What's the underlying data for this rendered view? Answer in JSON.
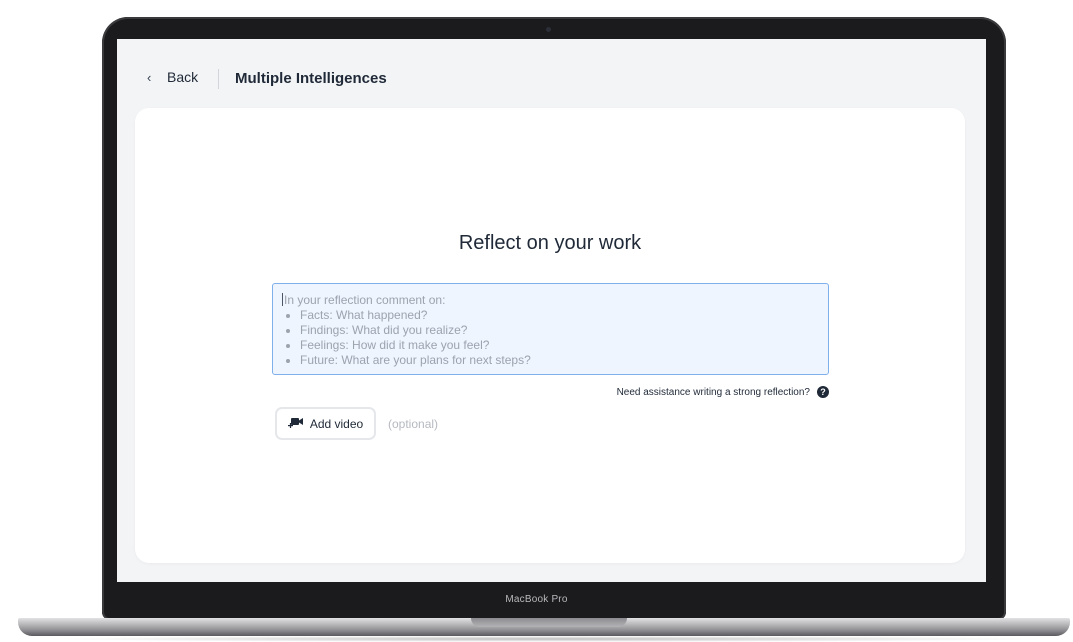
{
  "device": {
    "brand_label": "MacBook Pro"
  },
  "header": {
    "back_label": "Back",
    "title": "Multiple Intelligences"
  },
  "reflection": {
    "heading": "Reflect on your work",
    "intro": "In your reflection comment on:",
    "prompts": [
      "Facts: What happened?",
      "Findings: What did you realize?",
      "Feelings: How did it make you feel?",
      "Future: What are your plans for next steps?"
    ],
    "help_text": "Need assistance writing a strong reflection?",
    "help_icon": "question-circle-icon"
  },
  "video": {
    "button_label": "Add video",
    "optional_label": "(optional)",
    "icon": "video-camera-plus-icon"
  },
  "colors": {
    "accent_border": "#7fb0ea",
    "textarea_bg": "#eef5fe",
    "page_bg": "#f3f4f6"
  }
}
